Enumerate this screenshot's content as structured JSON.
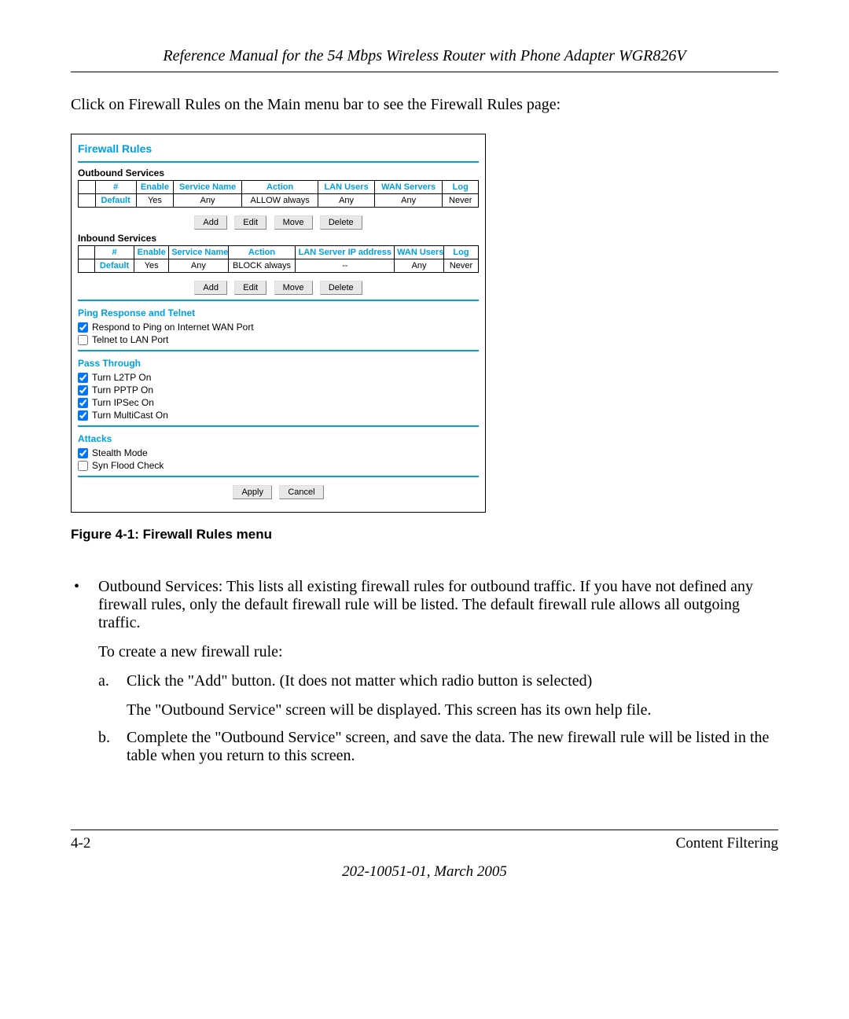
{
  "header": {
    "title": "Reference Manual for the 54 Mbps Wireless Router with Phone Adapter WGR826V"
  },
  "intro": "Click on Firewall Rules on the Main menu bar to see the Firewall Rules page:",
  "screenshot": {
    "title": "Firewall Rules",
    "outbound": {
      "heading": "Outbound Services",
      "headers": {
        "num": "#",
        "enable": "Enable",
        "service": "Service Name",
        "action": "Action",
        "lan_users": "LAN Users",
        "wan_servers": "WAN Servers",
        "log": "Log"
      },
      "row": {
        "num": "Default",
        "enable": "Yes",
        "service": "Any",
        "action": "ALLOW always",
        "lan_users": "Any",
        "wan_servers": "Any",
        "log": "Never"
      }
    },
    "buttons": {
      "add": "Add",
      "edit": "Edit",
      "move": "Move",
      "delete": "Delete",
      "apply": "Apply",
      "cancel": "Cancel"
    },
    "inbound": {
      "heading": "Inbound Services",
      "headers": {
        "num": "#",
        "enable": "Enable",
        "service": "Service Name",
        "action": "Action",
        "lan_server_ip": "LAN Server IP address",
        "wan_users": "WAN Users",
        "log": "Log"
      },
      "row": {
        "num": "Default",
        "enable": "Yes",
        "service": "Any",
        "action": "BLOCK always",
        "lan_server_ip": "--",
        "wan_users": "Any",
        "log": "Never"
      }
    },
    "ping": {
      "heading": "Ping Response and Telnet",
      "opt1": "Respond to Ping on Internet WAN Port",
      "opt2": "Telnet to LAN Port"
    },
    "passthrough": {
      "heading": "Pass Through",
      "opt1": "Turn L2TP On",
      "opt2": "Turn PPTP On",
      "opt3": "Turn IPSec On",
      "opt4": "Turn MultiCast On"
    },
    "attacks": {
      "heading": "Attacks",
      "opt1": "Stealth Mode",
      "opt2": "Syn Flood Check"
    }
  },
  "figure_caption": "Figure 4-1:  Firewall Rules menu",
  "bullet": {
    "lead": "Outbound Services: This lists all existing firewall rules for outbound traffic. If you have not defined any firewall rules, only the default firewall rule will be listed. The default firewall rule allows all outgoing traffic.",
    "subhead": "To create a new firewall rule:",
    "a": "Click the \"Add\" button. (It does not matter which radio button is selected)",
    "a2": "The \"Outbound Service\" screen will be displayed. This screen has its own help file.",
    "b": "Complete the \"Outbound Service\" screen, and save the data. The new firewall rule will be listed in the table when you return to this screen."
  },
  "footer": {
    "left": "4-2",
    "right": "Content Filtering",
    "center": "202-10051-01, March 2005"
  }
}
